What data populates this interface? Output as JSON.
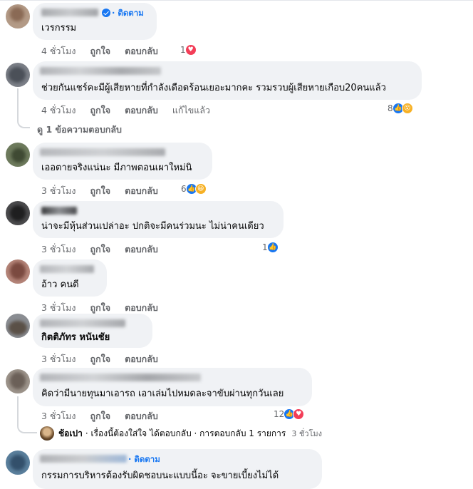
{
  "comments": [
    {
      "text": "เวรกรรม",
      "follow_label": "· ติดตาม",
      "time": "4 ชั่วโมง",
      "like_label": "ถูกใจ",
      "reply_label": "ตอบกลับ",
      "reaction_count": "1",
      "reactions": [
        "heart-icon"
      ]
    },
    {
      "text": "ช่วยกันแชร์คะมีผู้เสียหายที่กำลังเดือดร้อนเยอะมากคะ รวมรวบผู้เสียหายเกือบ20คนแล้ว",
      "time": "4 ชั่วโมง",
      "like_label": "ถูกใจ",
      "reply_label": "ตอบกลับ",
      "edited_label": "แก้ไขแล้ว",
      "reaction_count": "8",
      "reactions": [
        "like-icon",
        "wow-icon"
      ],
      "view_replies": "ดู 1 ข้อความตอบกลับ"
    },
    {
      "text": "เออตายจริงแน่นะ มีภาพตอนเผาใหม่นิ",
      "time": "3 ชั่วโมง",
      "like_label": "ถูกใจ",
      "reply_label": "ตอบกลับ",
      "reaction_count": "6",
      "reactions": [
        "like-icon",
        "haha-icon"
      ]
    },
    {
      "text": "น่าจะมีหุ้นส่วนเปล่าอะ ปกติจะมีคนร่วมนะ ไม่น่าคนเดียว",
      "time": "3 ชั่วโมง",
      "like_label": "ถูกใจ",
      "reply_label": "ตอบกลับ",
      "reaction_count": "1",
      "reactions": [
        "like-icon"
      ]
    },
    {
      "text": "อ้าว คนดี",
      "time": "3 ชั่วโมง",
      "like_label": "ถูกใจ",
      "reply_label": "ตอบกลับ"
    },
    {
      "text": "กิตติภัทร หนันชัย",
      "time": "3 ชั่วโมง",
      "like_label": "ถูกใจ",
      "reply_label": "ตอบกลับ"
    },
    {
      "text": "คิดว่ามีนายทุนมาเอารถ เอาเล่มไปหมดละจาขับผ่านทุกวันเลย",
      "time": "3 ชั่วโมง",
      "like_label": "ถูกใจ",
      "reply_label": "ตอบกลับ",
      "reaction_count": "12",
      "reactions": [
        "like-icon",
        "heart-icon"
      ],
      "reply": {
        "name": "ช้อเปา",
        "text": "· เรื่องนี้ต้องใส่ใจ ได้ตอบกลับ · การตอบกลับ 1 รายการ",
        "time": "3 ชั่วโมง"
      }
    },
    {
      "text": "กรรมการบริหารต้องรับผิดชอบนะแบบนี้อะ จะขายเบี้ยงไม่ได้",
      "follow_label": "· ติดตาม"
    }
  ],
  "colors": {
    "bubble": "#f0f2f5",
    "meta": "#65676b",
    "accent": "#1877f2",
    "heart": "#f33e58"
  }
}
